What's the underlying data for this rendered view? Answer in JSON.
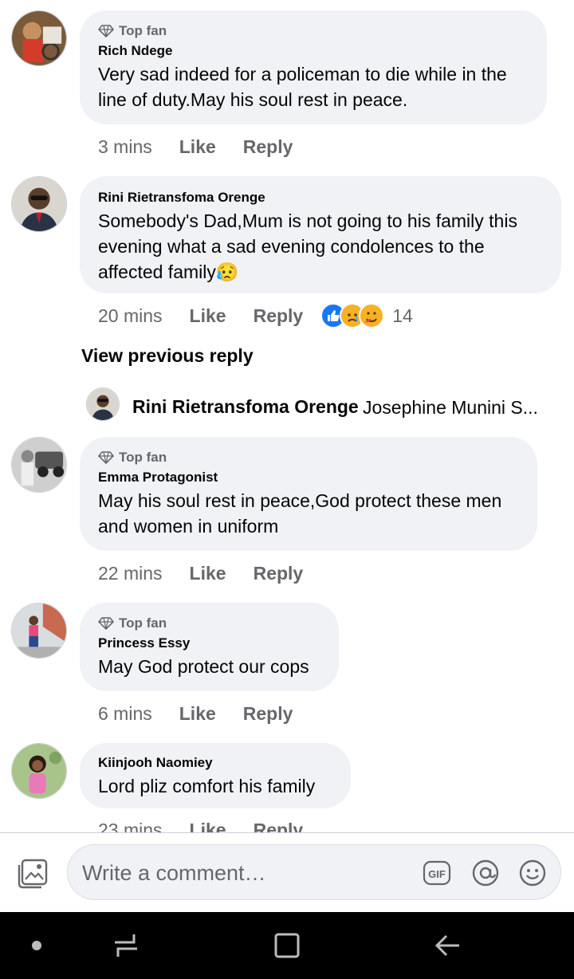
{
  "comments": [
    {
      "badge": "Top fan",
      "author": "Rich Ndege",
      "text": "Very sad indeed for a policeman to die while in the line of duty.May his soul rest in peace.",
      "time": "3 mins",
      "like": "Like",
      "reply": "Reply"
    },
    {
      "badge": "",
      "author": "Rini Rietransfoma Orenge",
      "text": "Somebody's Dad,Mum is not going to  his family this evening what a sad evening condolences to the affected family",
      "emoji": "😥",
      "time": "20 mins",
      "like": "Like",
      "reply": "Reply",
      "reaction_count": "14"
    },
    {
      "badge": "Top fan",
      "author": "Emma Protagonist",
      "text": "May his soul rest in peace,God protect these men and women in uniform",
      "time": "22 mins",
      "like": "Like",
      "reply": "Reply"
    },
    {
      "badge": "Top fan",
      "author": "Princess Essy",
      "text": "May God protect our cops",
      "time": "6 mins",
      "like": "Like",
      "reply": "Reply"
    },
    {
      "badge": "",
      "author": "Kiinjooh Naomiey",
      "text": "Lord pliz comfort his family",
      "time": "23 mins",
      "like": "Like",
      "reply": "Reply"
    }
  ],
  "view_previous_reply": "View previous reply",
  "reply_preview": {
    "author": "Rini Rietransfoma Orenge",
    "snippet": "Josephine Munini S..."
  },
  "composer": {
    "placeholder": "Write a comment…",
    "gif": "GIF"
  },
  "icons": {
    "badge": "diamond-icon",
    "photo": "photo-icon",
    "gif": "gif-icon",
    "mention": "at-icon",
    "emoji": "smiley-icon"
  },
  "colors": {
    "bubble": "#f0f2f5",
    "secondary_text": "#65676b",
    "like_blue": "#1877f2"
  }
}
